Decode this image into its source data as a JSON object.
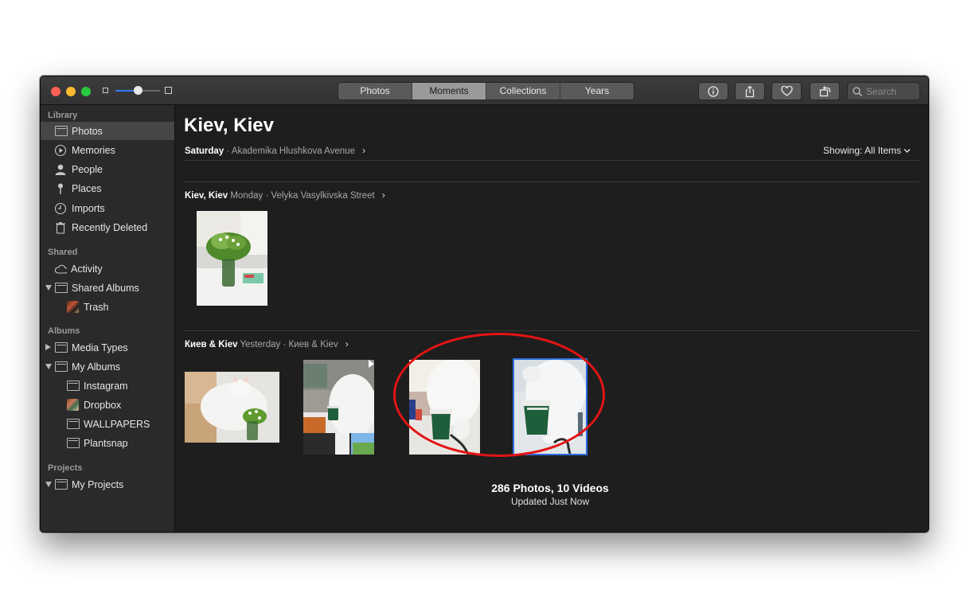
{
  "toolbar": {
    "tabs": [
      {
        "label": "Photos",
        "active": false
      },
      {
        "label": "Moments",
        "active": true
      },
      {
        "label": "Collections",
        "active": false
      },
      {
        "label": "Years",
        "active": false
      }
    ],
    "search_placeholder": "Search",
    "zoom_level": 0.5,
    "buttons": [
      "info-icon",
      "share-icon",
      "heart-icon",
      "rotate-icon"
    ]
  },
  "sidebar": {
    "library_header": "Library",
    "library": [
      {
        "label": "Photos",
        "icon": "photos-icon",
        "selected": true
      },
      {
        "label": "Memories",
        "icon": "memories-icon"
      },
      {
        "label": "People",
        "icon": "person-icon"
      },
      {
        "label": "Places",
        "icon": "pin-icon"
      },
      {
        "label": "Imports",
        "icon": "clock-icon"
      },
      {
        "label": "Recently Deleted",
        "icon": "trash-icon"
      }
    ],
    "shared_header": "Shared",
    "shared": [
      {
        "label": "Activity",
        "icon": "cloud-icon"
      },
      {
        "label": "Shared Albums",
        "icon": "folder-icon",
        "disclosure": "open"
      },
      {
        "label": "Trash",
        "icon": "album-thumb-icon"
      }
    ],
    "albums_header": "Albums",
    "albums": [
      {
        "label": "Media Types",
        "icon": "folder-icon",
        "disclosure": "closed"
      },
      {
        "label": "My Albums",
        "icon": "folder-icon",
        "disclosure": "open"
      },
      {
        "label": "Instagram",
        "icon": "folder-icon"
      },
      {
        "label": "Dropbox",
        "icon": "album-thumb-icon"
      },
      {
        "label": "WALLPAPERS",
        "icon": "folder-icon"
      },
      {
        "label": "Plantsnap",
        "icon": "folder-icon"
      }
    ],
    "projects_header": "Projects",
    "projects": [
      {
        "label": "My Projects",
        "icon": "folder-icon",
        "disclosure": "open"
      }
    ]
  },
  "main": {
    "title": "Kiev, Kiev",
    "subtitle_day": "Saturday",
    "subtitle_sep": "·",
    "subtitle_location": "Akademika Hlushkova Avenue",
    "showing_label": "Showing:",
    "showing_value": "All Items",
    "moments": [
      {
        "place": "Kiev, Kiev",
        "day": "Monday",
        "sep": "·",
        "street": "Velyka Vasylkivska Street"
      },
      {
        "place": "Киев & Kiev",
        "day": "Yesterday",
        "sep": "·",
        "street": "Киев & Kiev"
      }
    ],
    "stats_counts": "286 Photos, 10 Videos",
    "stats_updated": "Updated Just Now"
  },
  "colors": {
    "window_bg": "#1e1e1e",
    "sidebar_bg": "#2a2a2a",
    "selection": "#464646",
    "accent": "#2f7cf6",
    "annotation": "#e31414"
  }
}
